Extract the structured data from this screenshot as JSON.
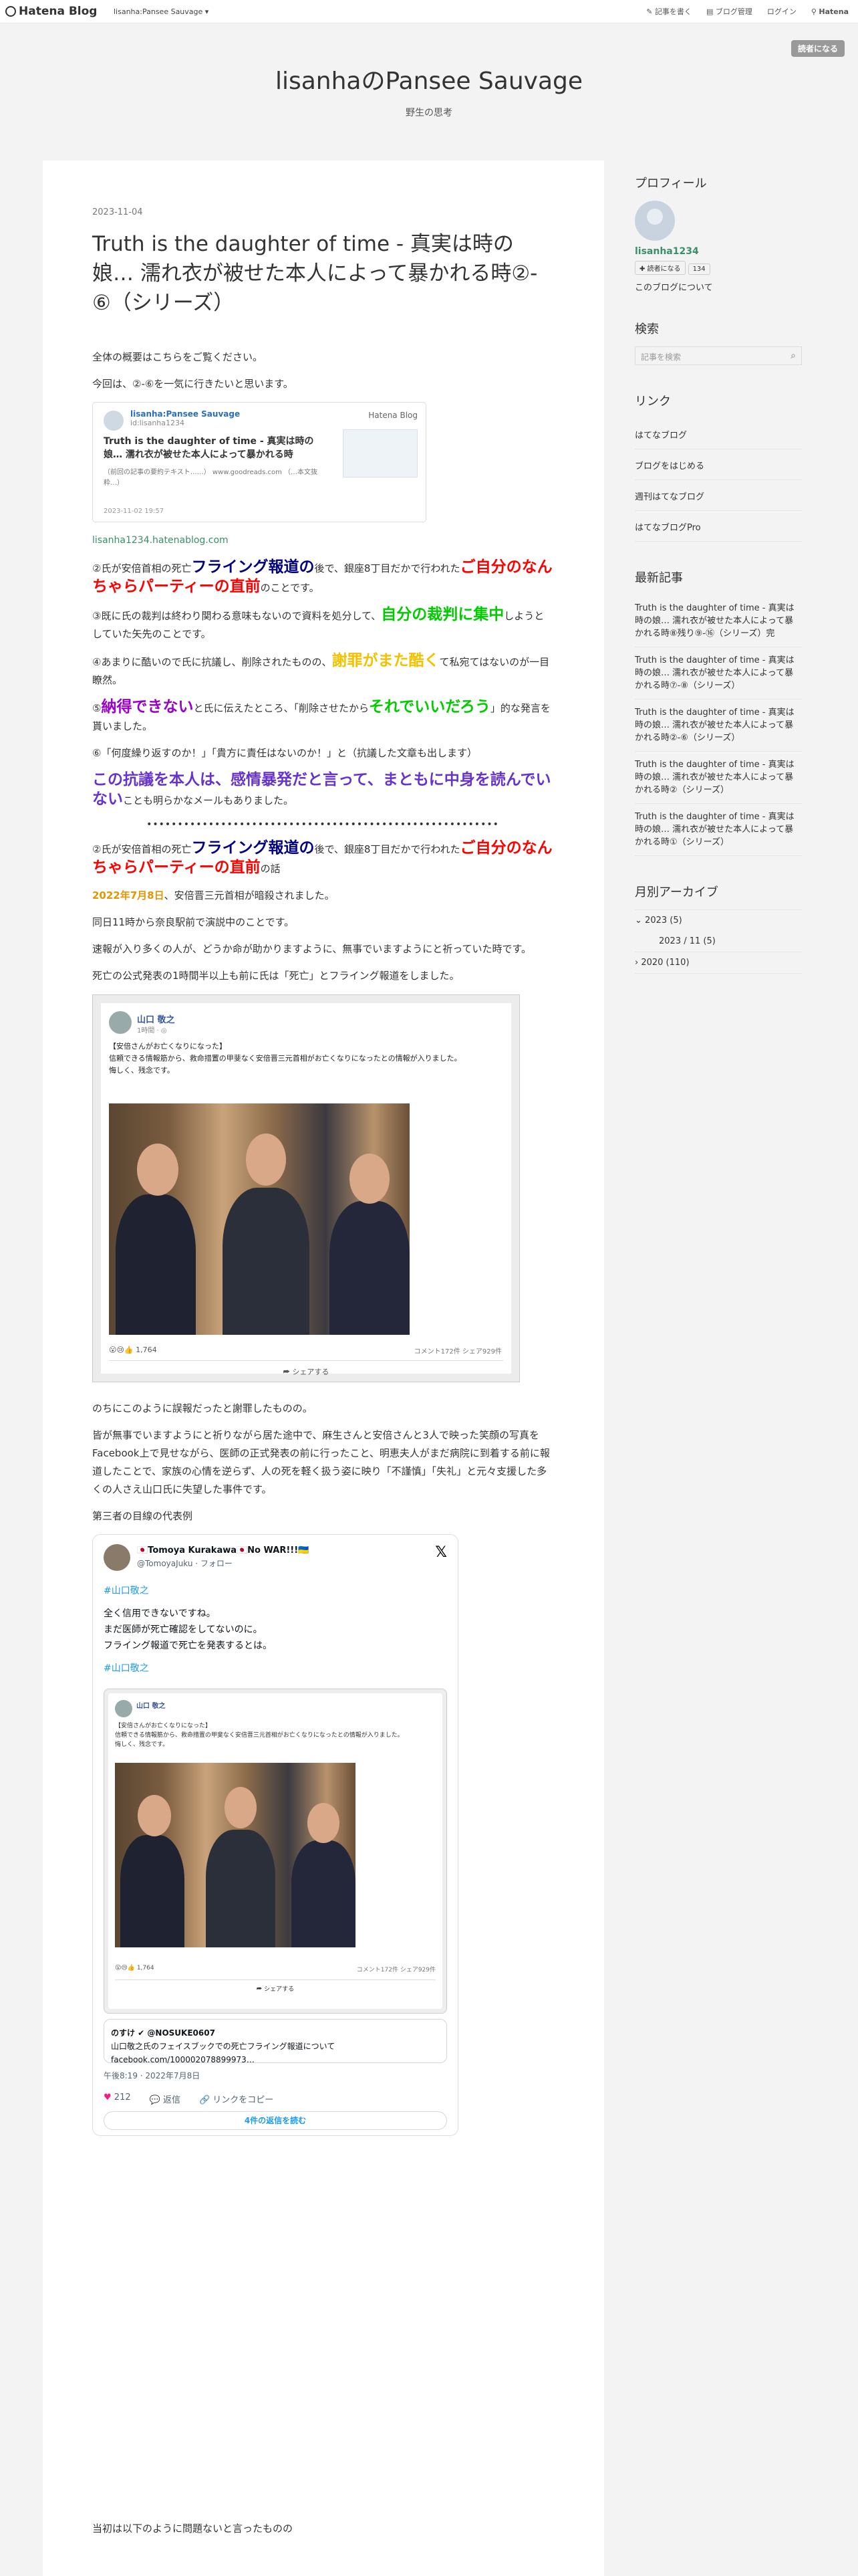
{
  "topbar": {
    "logo": "Hatena Blog",
    "blog_selector": "lisanha:Pansee Sauvage ▾",
    "link1": "記事を書く",
    "link2": "ブログ管理",
    "link3": "ログイン",
    "link4": "Hatena"
  },
  "subscribe_label": "読者になる",
  "blog": {
    "title": "lisanhaのPansee Sauvage",
    "description": "野生の思考"
  },
  "article": {
    "date": "2023-11-04",
    "title": "Truth is the daughter of time - 真実は時の娘… 濡れ衣が被せた本人によって暴かれる時②-⑥（シリーズ）",
    "p1": "全体の概要はこちらをご覧ください。",
    "p2": "今回は、②-⑥を一気に行きたいと思います。",
    "card": {
      "name": "lisanha:Pansee Sauvage",
      "id": "id:lisanha1234",
      "title": "Truth is the daughter of time - 真実は時の娘… 濡れ衣が被せた本人によって暴かれる時",
      "summary": "（前回の記事の要約テキスト……） www.goodreads.com （…本文抜粋…）",
      "date": "2023-11-02 19:57",
      "brand": "Hatena Blog"
    },
    "card_link": "lisanha1234.hatenablog.com",
    "s2": {
      "a": "②氏が安倍首相の死亡",
      "b": "フライング報道の",
      "c": "後で、銀座8丁目だかで行われた",
      "d": "ご自分のなんちゃらパーティーの直前",
      "e": "のことです。"
    },
    "s3": {
      "a": "③既に氏の裁判は終わり関わる意味もないので資料を処分して、",
      "b": "自分の裁判に集中",
      "c": "しようとしていた矢先のことです。"
    },
    "s4": {
      "a": "④あまりに酷いので氏に抗議し、削除されたものの、",
      "b": "謝罪がまた酷く",
      "c": "て私宛てはないのが一目瞭然。"
    },
    "s5": {
      "a": "⑤",
      "b": "納得できない",
      "c": "と氏に伝えたところ、「削除させたから",
      "d": "それでいいだろう",
      "e": "」的な発言を貰いました。"
    },
    "s6": "⑥「何度繰り返すのか！」「貴方に責任はないのか！」と（抗議した文章も出します）",
    "s7": {
      "a": "この抗議を本人は、感情暴発だと言って、まともに中身を読んでいない",
      "b": "ことも明らかなメールもありました。"
    },
    "dots": "•••••••••••••••••••••••••••••••••••••••••••••••••••••••••",
    "s8": {
      "a": "②氏が安倍首相の死亡",
      "b": "フライング報道の",
      "c": "後で、銀座8丁目だかで行われた",
      "d": "ご自分のなんちゃらパーティーの直前",
      "e": "の話"
    },
    "s9": {
      "a": "2022年7月8日",
      "b": "、安倍晋三元首相が暗殺されました。"
    },
    "s10": "同日11時から奈良駅前で演説中のことです。",
    "s11": "速報が入り多くの人が、どうか命が助かりますように、無事でいますようにと祈っていた時です。",
    "s12": "死亡の公式発表の1時間半以上も前に氏は「死亡」とフライング報道をしました。",
    "fb": {
      "name": "山口 敬之",
      "time": "1時間 · ◎",
      "text": "【安倍さんがお亡くなりになった】\n信頼できる情報筋から、救命措置の甲斐なく安倍晋三元首相がお亡くなりになったとの情報が入りました。\n悔しく、残念です。",
      "reactions": "😮😢👍 1,764",
      "stats": "コメント172件  シェア929件",
      "share": "⮫ シェアする"
    },
    "s13": "のちにこのように誤報だったと謝罪したものの。",
    "s14": "皆が無事でいますようにと祈りながら居た途中で、麻生さんと安倍さんと3人で映った笑顔の写真をFacebook上で見せながら、医師の正式発表の前に行ったこと、明恵夫人がまだ病院に到着する前に報道したことで、家族の心情を逆らず、人の死を軽く扱う姿に映り「不謹慎」「失礼」と元々支援した多くの人さえ山口氏に失望した事件です。",
    "s15": "第三者の目線の代表例",
    "tweet": {
      "name": "🇯🇵Tomoya Kurakawa🇯🇵No WAR!!!🇺🇦",
      "handle": "@TomoyaJuku · フォロー",
      "hashtag1": "#山口敬之",
      "line1": "全く信用できないですね。",
      "line2": "まだ医師が死亡確認をしてないのに。",
      "line3": "フライング報道で死亡を発表するとは。",
      "hashtag2": "#山口敬之",
      "q2name": "のすけ ✔ @NOSUKE0607",
      "q2text": "山口敬之氏のフェイスブックでの死亡フライング報道について facebook.com/100002078899973…",
      "date": "午後8:19 · 2022年7月8日",
      "likes": "212",
      "reply": "返信",
      "copy": "リンクをコピー",
      "more": "4件の返信を読む"
    },
    "s16": "当初は以下のように問題ないと言ったものの"
  },
  "sidebar": {
    "profile_h": "プロフィール",
    "username": "lisanha1234",
    "read_btn": "✚ 読者になる",
    "read_count": "134",
    "about": "このブログについて",
    "search_h": "検索",
    "search_placeholder": "記事を検索",
    "links_h": "リンク",
    "links": [
      "はてなブログ",
      "ブログをはじめる",
      "週刊はてなブログ",
      "はてなブログPro"
    ],
    "recent_h": "最新記事",
    "recent": [
      "Truth is the daughter of time - 真実は時の娘… 濡れ衣が被せた本人によって暴かれる時⑧残り⑨-⑯（シリーズ）完",
      "Truth is the daughter of time - 真実は時の娘… 濡れ衣が被せた本人によって暴かれる時⑦-⑧（シリーズ）",
      "Truth is the daughter of time - 真実は時の娘… 濡れ衣が被せた本人によって暴かれる時②-⑥（シリーズ）",
      "Truth is the daughter of time - 真実は時の娘… 濡れ衣が被せた本人によって暴かれる時②（シリーズ）",
      "Truth is the daughter of time - 真実は時の娘… 濡れ衣が被せた本人によって暴かれる時①（シリーズ）"
    ],
    "archive_h": "月別アーカイブ",
    "archive": [
      {
        "label": "2023 (5)"
      },
      {
        "label": "2023 / 11 (5)"
      },
      {
        "label": "2020 (110)"
      }
    ]
  }
}
